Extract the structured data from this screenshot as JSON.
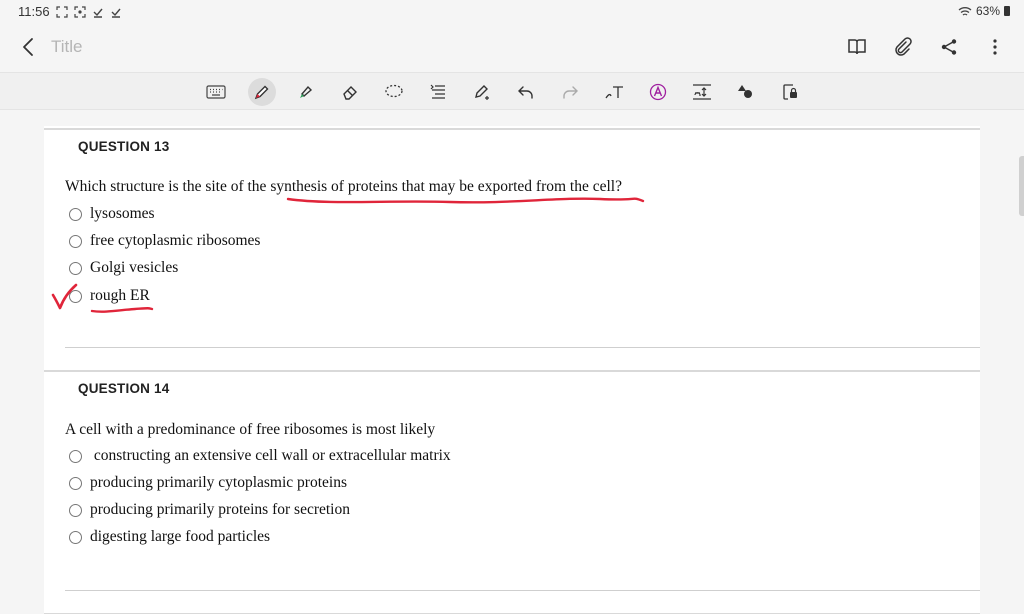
{
  "status": {
    "time": "11:56",
    "battery": "63%"
  },
  "titlebar": {
    "title": "Title"
  },
  "toolbar": {
    "tools": [
      "keyboard-icon",
      "pen-icon",
      "highlighter-icon",
      "eraser-icon",
      "lasso-icon",
      "text-format-icon",
      "pen-settings-icon",
      "undo-icon",
      "redo-icon",
      "handwriting-to-text-icon",
      "text-style-icon",
      "text-box-icon",
      "shapes-icon",
      "lock-icon"
    ],
    "active_tool": "pen-icon"
  },
  "questions": [
    {
      "heading": "QUESTION 13",
      "text": "Which structure is the site of the synthesis of proteins that may be exported from the cell?",
      "options": [
        "lysosomes",
        "free cytoplasmic ribosomes",
        "Golgi vesicles",
        "rough ER"
      ]
    },
    {
      "heading": "QUESTION 14",
      "text": "A cell with a predominance of free ribosomes is most likely",
      "options": [
        " constructing an extensive cell wall or extracellular matrix",
        "producing primarily cytoplasmic proteins",
        "producing primarily proteins for secretion",
        "digesting large food particles"
      ]
    }
  ],
  "colors": {
    "ink": "#e0253a",
    "accent": "#a020a0"
  }
}
